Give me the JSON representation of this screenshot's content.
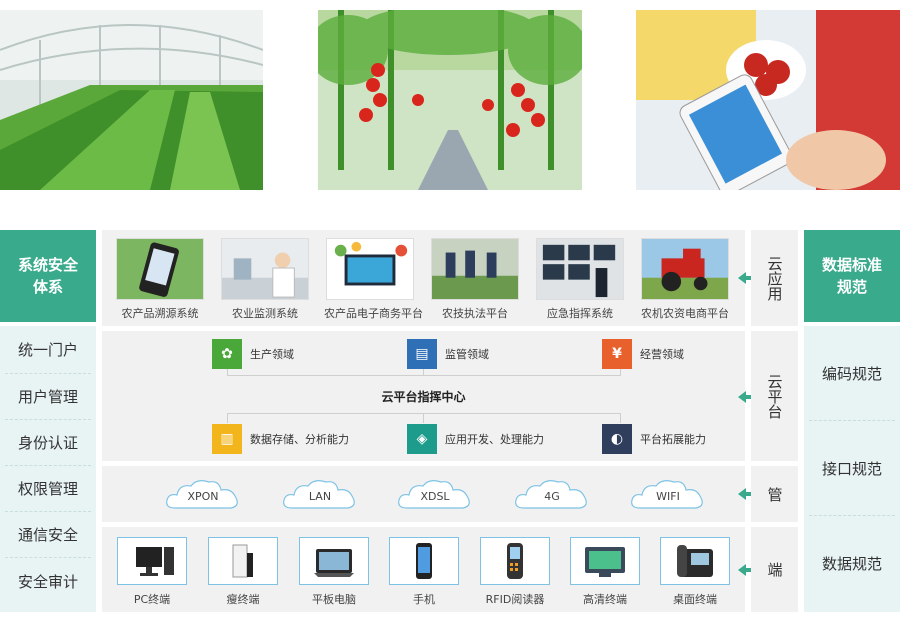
{
  "left": {
    "header": "系统安全体系",
    "items": [
      "统一门户",
      "用户管理",
      "身份认证",
      "权限管理",
      "通信安全",
      "安全审计"
    ]
  },
  "right": {
    "header": "数据标准规范",
    "items": [
      "编码规范",
      "接口规范",
      "数据规范"
    ]
  },
  "layers": {
    "app": {
      "tag": "云应用",
      "items": [
        "农产品溯源系统",
        "农业监测系统",
        "农产品电子商务平台",
        "农技执法平台",
        "应急指挥系统",
        "农机农资电商平台"
      ]
    },
    "cloud": {
      "tag": "云平台",
      "center": "云平台指挥中心",
      "top_nodes": [
        "生产领域",
        "监管领域",
        "经营领域"
      ],
      "bottom_nodes": [
        "数据存储、分析能力",
        "应用开发、处理能力",
        "平台拓展能力"
      ]
    },
    "pipe": {
      "tag": "管",
      "items": [
        "XPON",
        "LAN",
        "XDSL",
        "4G",
        "WIFI"
      ]
    },
    "end": {
      "tag": "端",
      "items": [
        "PC终端",
        "瘦终端",
        "平板电脑",
        "手机",
        "RFID阅读器",
        "高清终端",
        "桌面终端"
      ]
    }
  },
  "colors": {
    "accent": "#3aaa8c",
    "panel": "#f1f1f1",
    "side_panel": "#e8f3f3",
    "icon_green": "#4aa83a",
    "icon_blue": "#2e6fb5",
    "icon_orange": "#e8602c",
    "icon_yellow": "#f2b51c",
    "icon_teal": "#1d9c8c",
    "icon_navy": "#2f3e5c"
  }
}
